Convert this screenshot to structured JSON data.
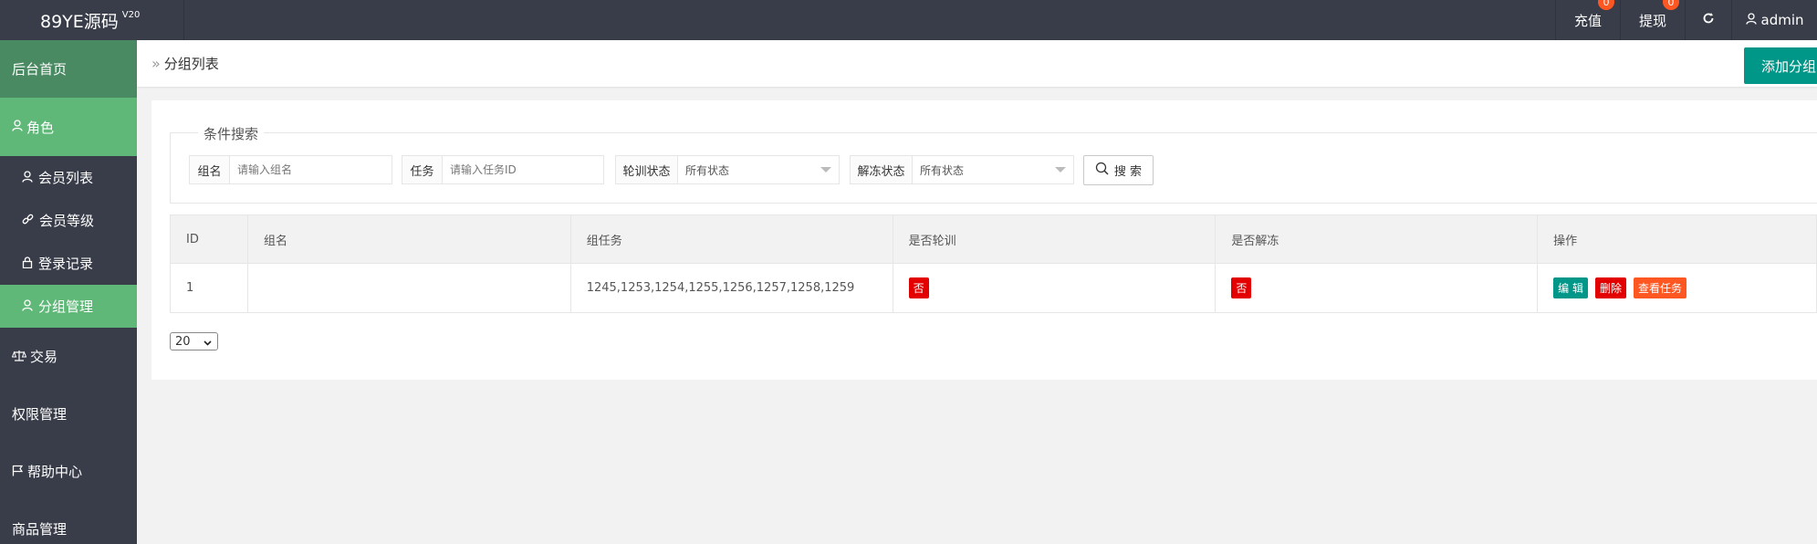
{
  "header": {
    "logo_text": "89YE源码",
    "logo_version": "V20",
    "recharge_label": "充值",
    "recharge_badge": "0",
    "withdraw_label": "提现",
    "withdraw_badge": "0",
    "user_name": "admin",
    "icons": {
      "refresh": "refresh-icon",
      "user": "user-icon"
    }
  },
  "sidebar": {
    "items": [
      {
        "label": "后台首页"
      },
      {
        "label": "角色",
        "icon": "user-icon"
      },
      {
        "label": "会员列表",
        "icon": "user-icon"
      },
      {
        "label": "会员等级",
        "icon": "link-icon"
      },
      {
        "label": "登录记录",
        "icon": "lock-icon"
      },
      {
        "label": "分组管理",
        "icon": "user-icon"
      },
      {
        "label": "交易",
        "icon": "scale-icon"
      },
      {
        "label": "权限管理"
      },
      {
        "label": "帮助中心",
        "icon": "flag-icon"
      },
      {
        "label": "商品管理"
      }
    ]
  },
  "breadcrumb": {
    "title": "分组列表",
    "add_button": "添加分组"
  },
  "search": {
    "legend": "条件搜索",
    "group_label": "组名",
    "group_placeholder": "请输入组名",
    "task_label": "任务",
    "task_placeholder": "请输入任务ID",
    "train_label": "轮训状态",
    "train_value": "所有状态",
    "thaw_label": "解冻状态",
    "thaw_value": "所有状态",
    "search_button": "搜 索"
  },
  "table": {
    "headers": [
      "ID",
      "组名",
      "组任务",
      "是否轮训",
      "是否解冻",
      "操作"
    ],
    "rows": [
      {
        "id": "1",
        "name": "",
        "tasks": "1245,1253,1254,1255,1256,1257,1258,1259",
        "train": "否",
        "thaw": "否",
        "ops": {
          "edit": "编 辑",
          "delete": "删除",
          "view": "查看任务"
        }
      }
    ]
  },
  "pagination": {
    "page_size": "20"
  },
  "colors": {
    "header_bg": "#393d49",
    "active_green": "#5fb878",
    "home_green": "#4a8a63",
    "teal": "#009688",
    "red": "#e30000",
    "orange": "#ff5722"
  }
}
